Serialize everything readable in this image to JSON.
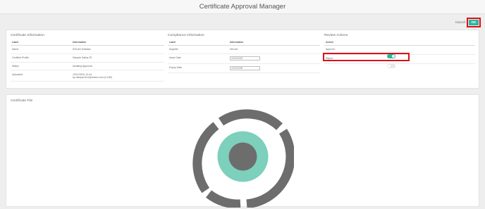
{
  "app": {
    "title": "Certificate Approval Manager"
  },
  "actions": {
    "cancel_label": "Cancel",
    "ok_label": "OK"
  },
  "certificate_info": {
    "title": "Certificate Information",
    "col_label": "Label",
    "col_info": "Information",
    "rows": [
      {
        "label": "Name",
        "value": "SOLAS Sofasea"
      },
      {
        "label": "Certified Profile",
        "value": "Sample Dallas Tit"
      },
      {
        "label": "Status",
        "value": "Awaiting Approval"
      },
      {
        "label": "Uploaded",
        "value": "10/11/2020 12:44",
        "value2": "by daniyar1111@xmrks.com (2-189)"
      }
    ]
  },
  "compliance_info": {
    "title": "Compliance Information",
    "col_label": "Label",
    "col_info": "Information",
    "rows": [
      {
        "label": "Supplier",
        "value": "Not set"
      },
      {
        "label": "Issue Date",
        "value": "10/11/2020"
      },
      {
        "label": "Expiry Date",
        "value": "10/11/2030"
      }
    ]
  },
  "review_actions": {
    "title": "Review Actions",
    "col_action": "Action",
    "items": [
      {
        "label": "Approve",
        "state": "on"
      },
      {
        "label": "Reject",
        "state": "off"
      }
    ]
  },
  "certificate_file": {
    "title": "Certificate File"
  },
  "colors": {
    "accent": "#29b89d",
    "highlight": "#dd0f18",
    "ring": "#6d6d6d"
  },
  "icons": {
    "file_preview": "certificate-seal-graphic"
  }
}
